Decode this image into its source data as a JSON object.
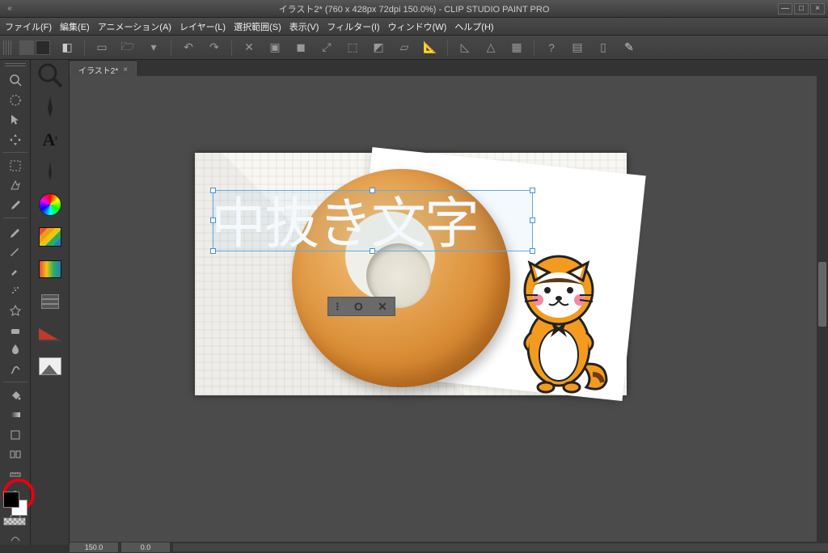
{
  "titlebar": {
    "title": "イラスト2* (760 x 428px 72dpi 150.0%)  -  CLIP STUDIO PAINT PRO"
  },
  "window_controls": {
    "min": "—",
    "max": "□",
    "close": "×"
  },
  "menu": {
    "file": "ファイル(F)",
    "edit": "編集(E)",
    "animation": "アニメーション(A)",
    "layer": "レイヤー(L)",
    "selection": "選択範囲(S)",
    "view": "表示(V)",
    "filter": "フィルター(I)",
    "window": "ウィンドウ(W)",
    "help": "ヘルプ(H)"
  },
  "document": {
    "tab_label": "イラスト2*",
    "tab_close": "×"
  },
  "canvas": {
    "text": "中抜き文字",
    "confirm_bar": {
      "drag": "⁝",
      "ok": "O",
      "cancel": "✕"
    }
  },
  "status": {
    "zoom": "150.0",
    "angle": "0.0"
  },
  "tools": {
    "magnifier": "magnifier",
    "move_hand": "move",
    "operation": "operation",
    "layer_move": "layer-move",
    "marquee": "marquee-select",
    "auto_select": "auto-select",
    "pen": "pen",
    "pencil": "pencil",
    "brush": "brush",
    "airbrush": "airbrush",
    "decoration": "decoration",
    "eraser": "eraser",
    "blend": "blend",
    "fill": "fill",
    "gradient": "gradient",
    "figure": "figure",
    "frame": "frame",
    "ruler": "ruler",
    "text": "A",
    "balloon": "balloon",
    "correct_line": "correct-line",
    "eyedropper": "eyedropper"
  },
  "subtools": {
    "magnifier_q": "Q",
    "pen_bold": "pen",
    "pen_a": "A",
    "pen_thin": "pen-thin",
    "color_wheel": "color-wheel",
    "color_set": "color-set",
    "gradient": "gradient",
    "layers": "layers",
    "brush_size": "brush-size",
    "sub_view": "sub-view"
  },
  "highlight": {
    "tool": "text"
  }
}
